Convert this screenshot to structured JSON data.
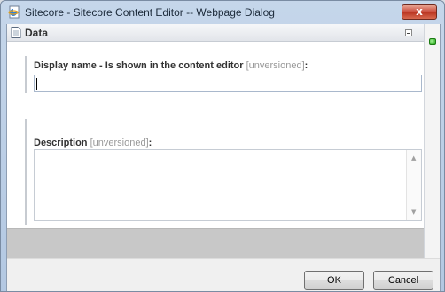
{
  "window": {
    "title": "Sitecore - Sitecore Content Editor -- Webpage Dialog",
    "close_label": "x"
  },
  "section": {
    "title": "Data"
  },
  "fields": {
    "display_name": {
      "label": "Display name - Is shown in the content editor",
      "tag": "[unversioned]",
      "colon": ":",
      "value": ""
    },
    "description": {
      "label": "Description",
      "tag": "[unversioned]",
      "colon": ":",
      "value": ""
    }
  },
  "buttons": {
    "ok": "OK",
    "cancel": "Cancel"
  },
  "icons": {
    "window": "ie-page-icon",
    "section": "document-icon",
    "collapse": "collapse-minus-icon",
    "status": "green-status-icon"
  },
  "colors": {
    "close_button": "#c9493a",
    "status_green": "#26a61a",
    "input_border": "#a9b8cc"
  }
}
